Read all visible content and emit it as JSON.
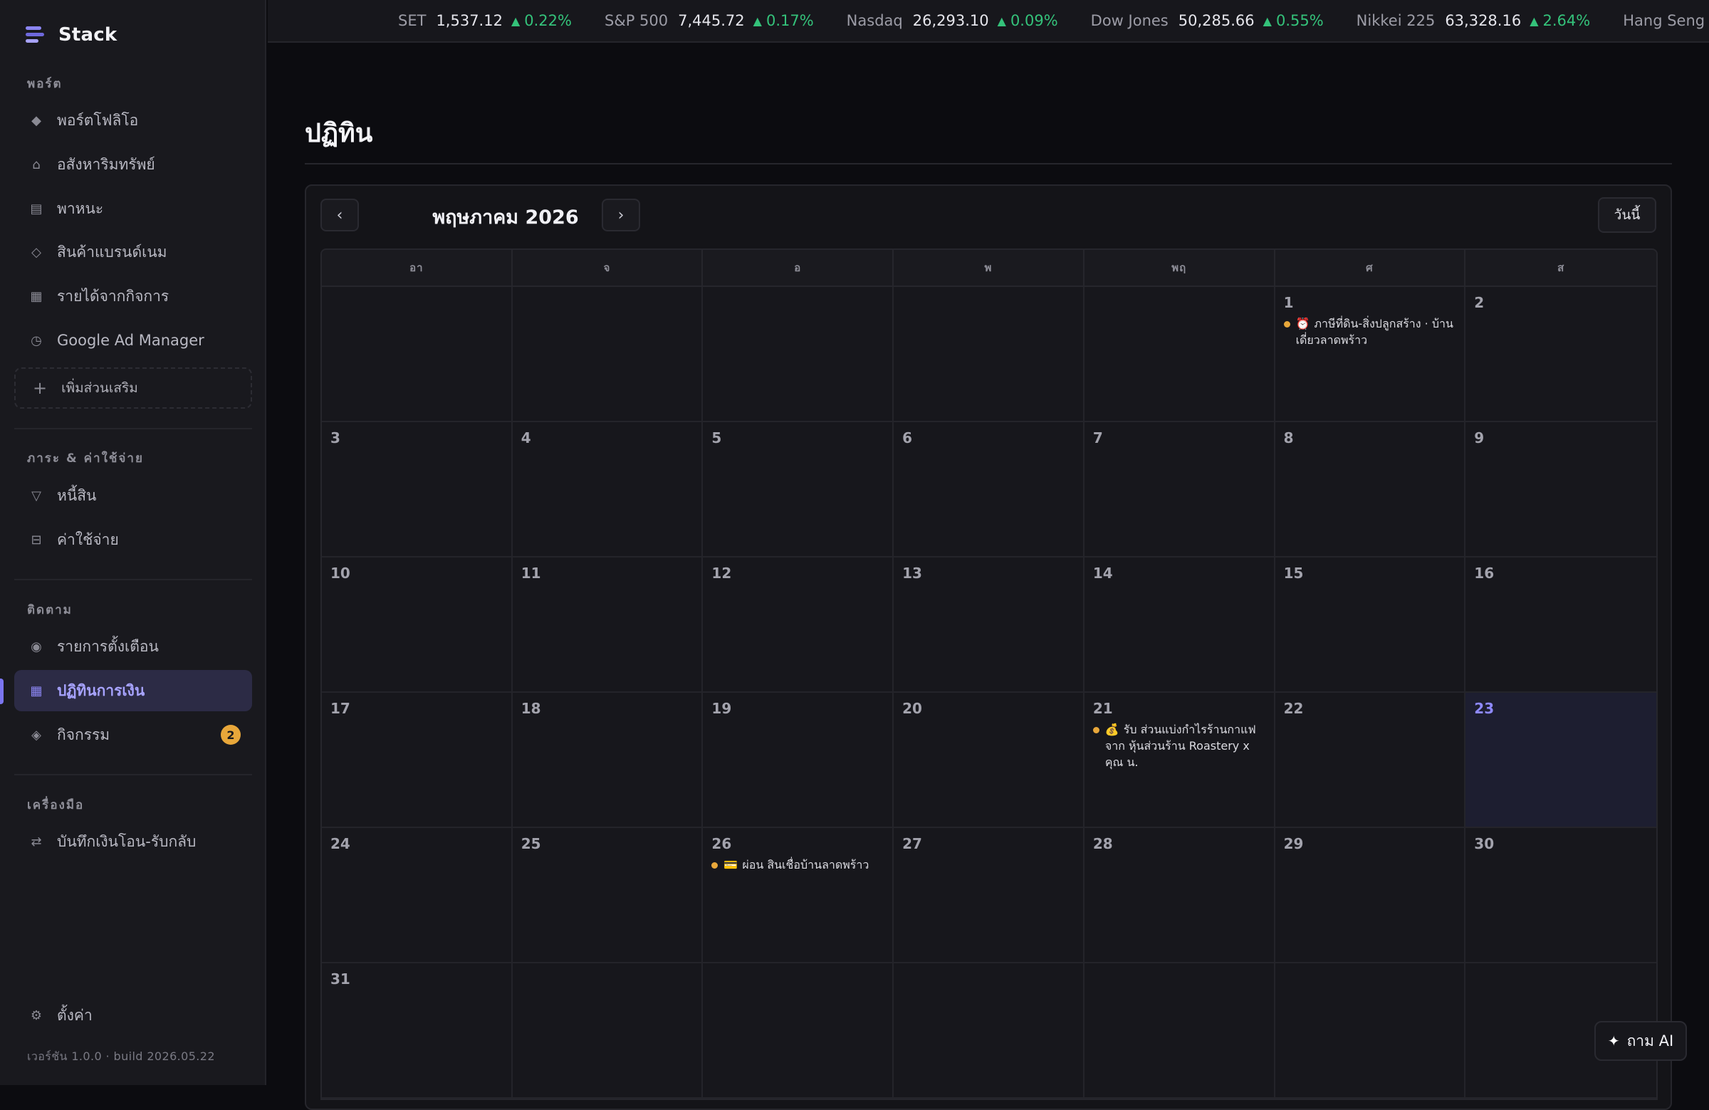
{
  "app": {
    "name": "Stack",
    "version": "เวอร์ชัน 1.0.0 · build 2026.05.22"
  },
  "sidebar": {
    "sections": {
      "portfolio": "พอร์ต",
      "debts": "ภาระ & ค่าใช้จ่าย",
      "tracking": "ติดตาม",
      "tools": "เครื่องมือ"
    },
    "items": {
      "portfolio": "พอร์ตโฟลิโอ",
      "real_estate": "อสังหาริมทรัพย์",
      "vehicles": "พาหนะ",
      "brand_goods": "สินค้าแบรนด์เนม",
      "business_income": "รายได้จากกิจการ",
      "google_ad_manager": "Google Ad Manager",
      "add_extension": "เพิ่มส่วนเสริม",
      "liabilities": "หนี้สิน",
      "expenses": "ค่าใช้จ่าย",
      "reminders": "รายการตั้งเตือน",
      "finance_calendar": "ปฏิทินการเงิน",
      "activities": "กิจกรรม",
      "activities_badge": "2",
      "transfers": "บันทึกเงินโอน-รับกลับ",
      "settings": "ตั้งค่า"
    },
    "icons": {
      "portfolio": "diamond-icon",
      "real_estate": "home-icon",
      "vehicles": "vehicle-icon",
      "brand_goods": "gem-icon",
      "business_income": "building-icon",
      "google_ad_manager": "clock-icon",
      "add_extension": "plus-icon",
      "liabilities": "triangle-down-icon",
      "expenses": "receipt-icon",
      "reminders": "bell-icon",
      "finance_calendar": "calendar-icon",
      "activities": "activity-icon",
      "transfers": "transfer-icon",
      "settings": "gear-icon"
    }
  },
  "ticker": [
    {
      "name": "SET",
      "value": "1,537.12",
      "change": "0.22%"
    },
    {
      "name": "S&P 500",
      "value": "7,445.72",
      "change": "0.17%"
    },
    {
      "name": "Nasdaq",
      "value": "26,293.10",
      "change": "0.09%"
    },
    {
      "name": "Dow Jones",
      "value": "50,285.66",
      "change": "0.55%"
    },
    {
      "name": "Nikkei 225",
      "value": "63,328.16",
      "change": "2.64%"
    },
    {
      "name": "Hang Seng",
      "value": "",
      "change": ""
    }
  ],
  "main": {
    "title": "ปฏิทิน",
    "calendar": {
      "month_label": "พฤษภาคม 2026",
      "prev_label": "‹",
      "next_label": "›",
      "today_label": "วันนี้",
      "weekdays": [
        "อา",
        "จ",
        "อ",
        "พ",
        "พฤ",
        "ศ",
        "ส"
      ],
      "leading_blanks": 5,
      "days_in_month": 31,
      "today": 23,
      "events": {
        "1": [
          {
            "emoji": "⏰",
            "text": "ภาษีที่ดิน-สิ่งปลูกสร้าง · บ้านเดี่ยวลาดพร้าว"
          }
        ],
        "21": [
          {
            "emoji": "💰",
            "text": "รับ ส่วนแบ่งกำไรร้านกาแฟ จาก หุ้นส่วนร้าน Roastery x คุณ น."
          }
        ],
        "26": [
          {
            "emoji": "💳",
            "text": "ผ่อน สินเชื่อบ้านลาดพร้าว"
          }
        ]
      },
      "event_color": "#e8a73a"
    }
  },
  "ask_ai": {
    "label": "ถาม AI"
  },
  "colors": {
    "accent": "#8b85f2",
    "up": "#34c27a",
    "badge": "#e8a73a"
  }
}
